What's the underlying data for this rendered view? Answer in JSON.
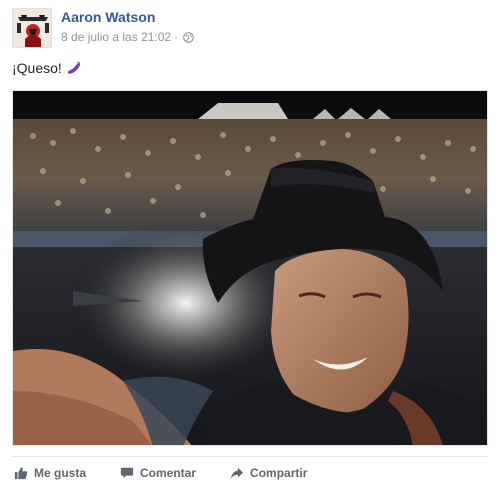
{
  "post": {
    "author": "Aaron Watson",
    "timestamp": "8 de julio a las 21:02",
    "separator": "·",
    "privacy_icon": "globe-icon",
    "message": "¡Queso!",
    "message_emoji": "eggplant-emoji",
    "photo_description_icon": "photo"
  },
  "actions": {
    "like_label": "Me gusta",
    "comment_label": "Comentar",
    "share_label": "Compartir"
  },
  "colors": {
    "author_link": "#365899",
    "meta_text": "#90949c",
    "action_text": "#616770",
    "divider": "#e5e5e5"
  }
}
